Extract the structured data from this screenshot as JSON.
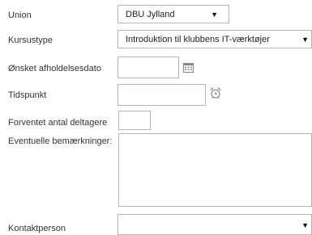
{
  "form": {
    "union": {
      "label": "Union",
      "value": "DBU Jylland"
    },
    "kursustype": {
      "label": "Kursustype",
      "value": "Introduktion til klubbens IT-værktøjer"
    },
    "dato": {
      "label": "Ønsket afholdelsesdato",
      "value": "",
      "icon": "calendar-icon"
    },
    "tidspunkt": {
      "label": "Tidspunkt",
      "value": "",
      "icon": "alarm-clock-icon"
    },
    "deltagere": {
      "label": "Forventet antal deltagere",
      "value": ""
    },
    "bemaerkninger": {
      "label": "Eventuelle bemærkninger:",
      "value": ""
    },
    "kontaktperson": {
      "label": "Kontaktperson",
      "value": ""
    }
  },
  "colors": {
    "border": "#b5b5b5",
    "text": "#333333",
    "icon": "#888888"
  }
}
